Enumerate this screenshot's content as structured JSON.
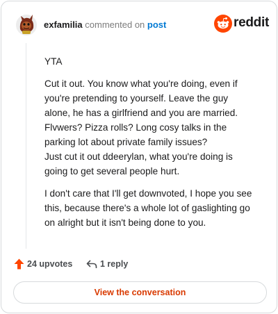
{
  "header": {
    "username": "exfamilia",
    "commented_on": "commented on",
    "post_link": "post",
    "brand": "reddit"
  },
  "comment": {
    "paragraphs": [
      [
        "YTA"
      ],
      [
        "Cut it out. You know what you're doing, even if",
        "you're pretending to yourself. Leave the guy",
        "alone, he has a girlfriend and you are married.",
        "Flvwers? Pizza rolls? Long cosy talks in the",
        "parking lot about private family issues?",
        "Just cut it out ddeerylan, what you're doing is",
        "going to get several people hurt."
      ],
      [
        "I don't care that I'll get downvoted, I hope you see",
        "this, because there's a whole lot of gaslighting go",
        "on alright but it isn't being done to you."
      ]
    ]
  },
  "actions": {
    "upvotes": "24 upvotes",
    "replies": "1 reply"
  },
  "cta": {
    "label": "View the conversation"
  },
  "colors": {
    "brand_orange": "#ff4500",
    "link_blue": "#0079d3",
    "cta_text": "#d93a00"
  },
  "icons": {
    "avatar": "user-avatar",
    "brand": "reddit-snoo-icon",
    "upvote": "upvote-arrow-icon",
    "reply": "reply-arrow-icon"
  }
}
